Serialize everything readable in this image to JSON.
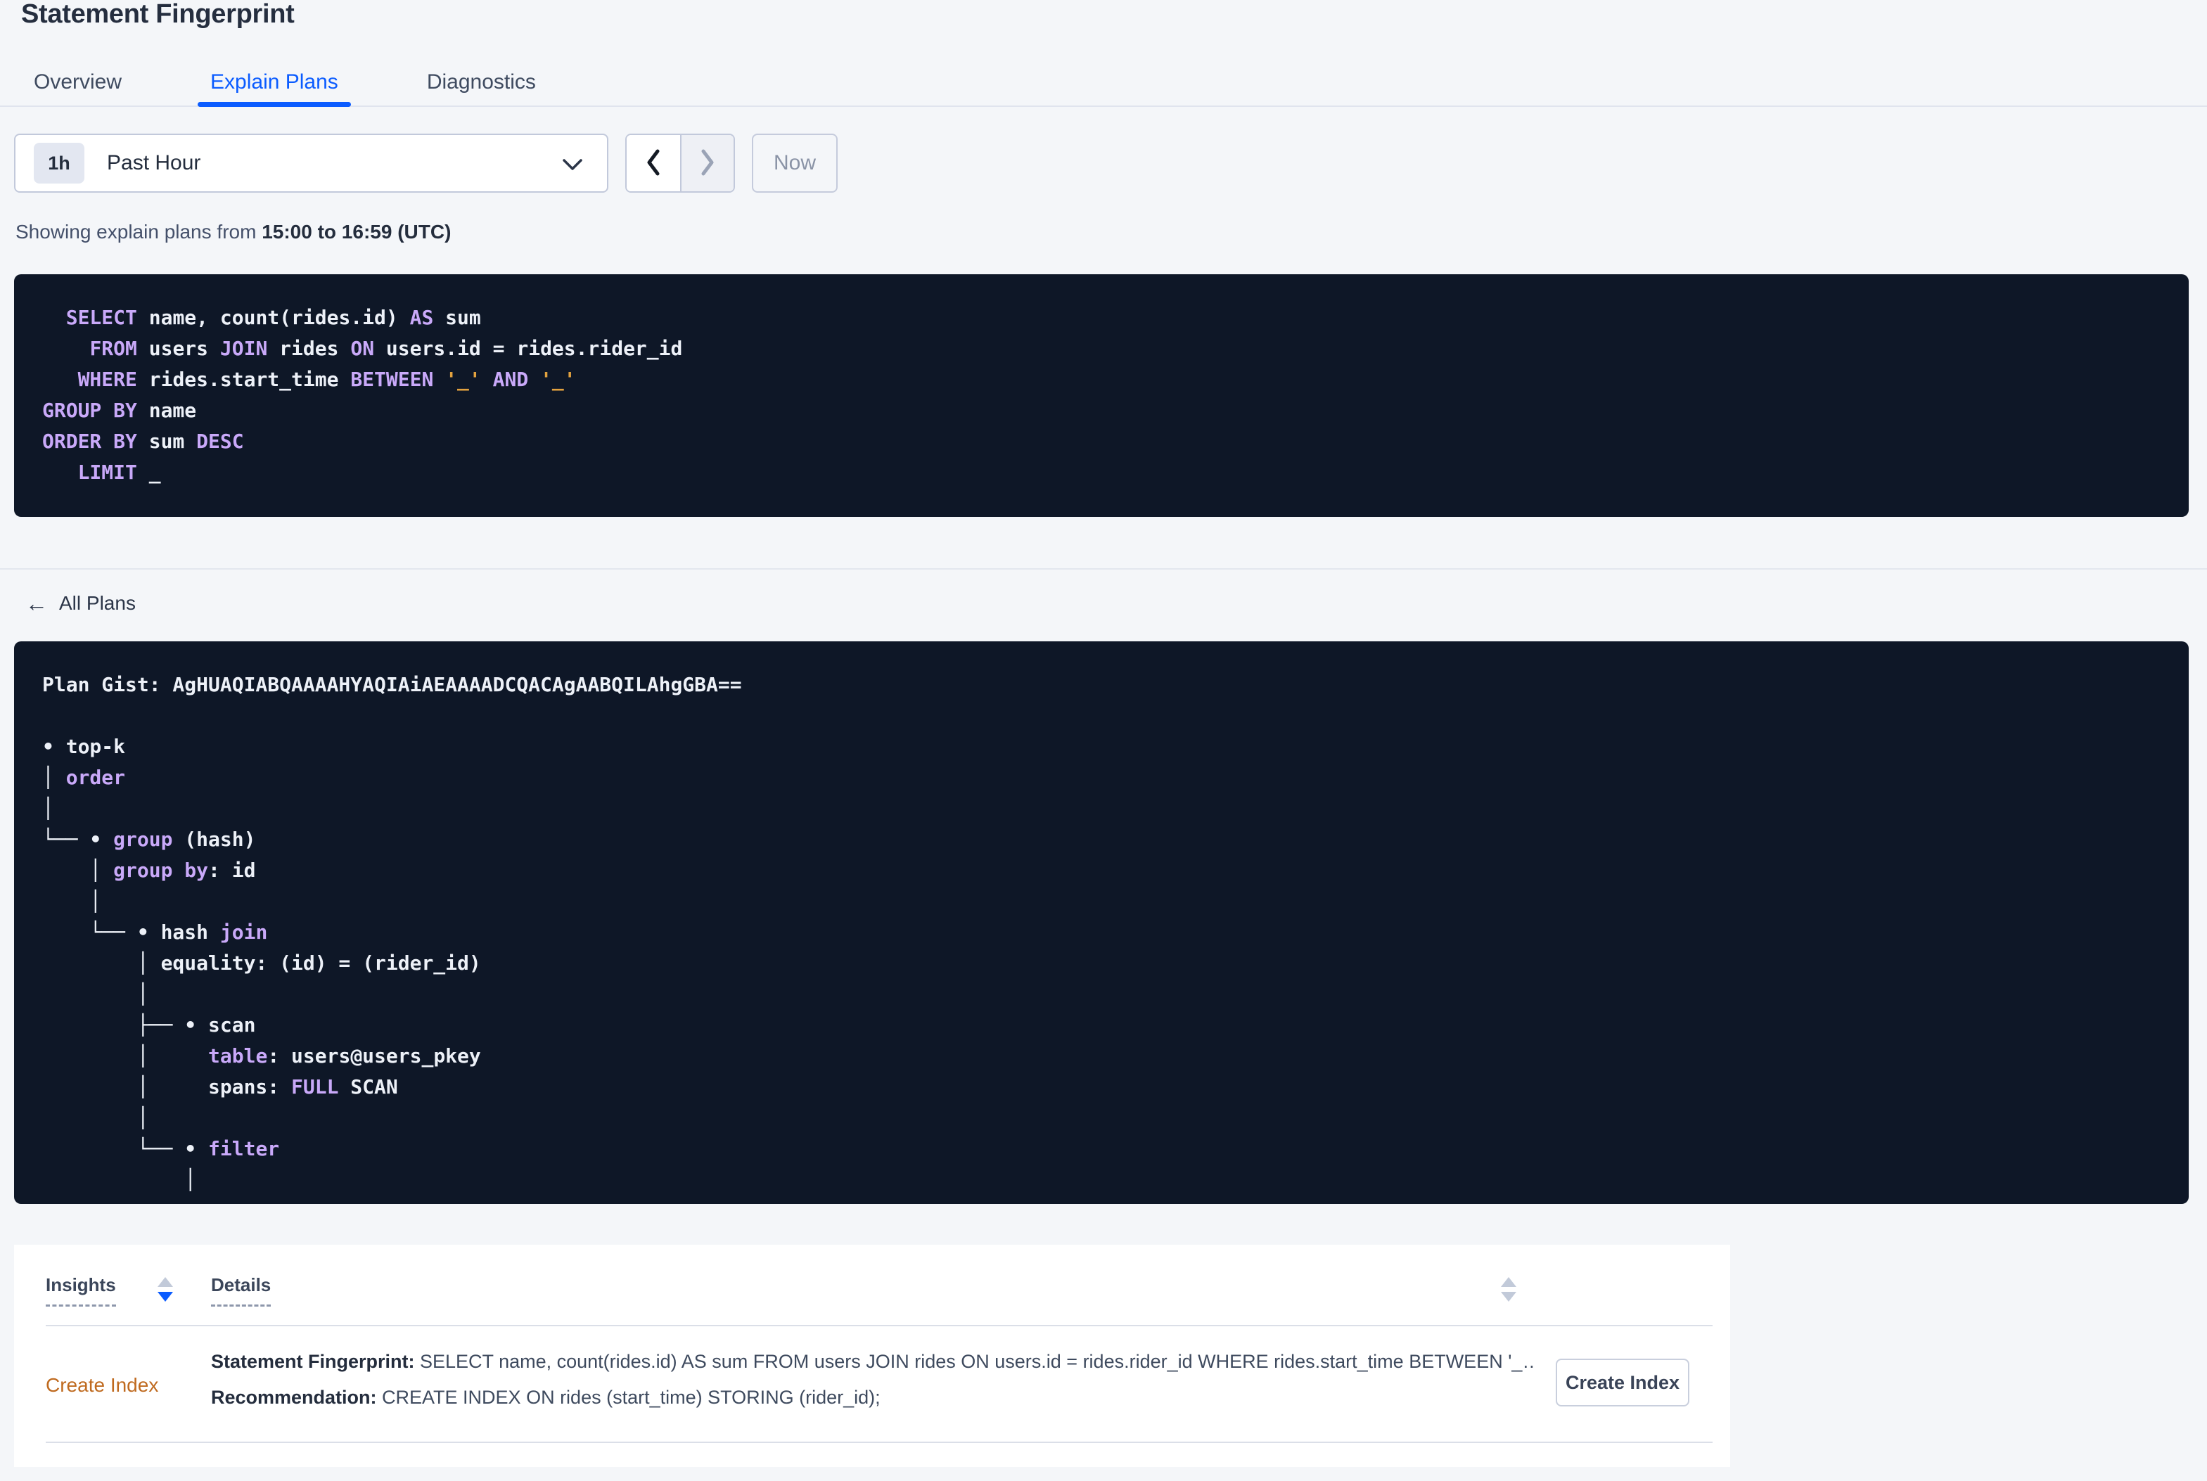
{
  "colors": {
    "accent_blue": "#0b5cff",
    "keyword_purple": "#c9a9f9",
    "string_orange": "#e2a23f",
    "insight_orange": "#bf6a1f",
    "code_background": "#0e1727"
  },
  "page": {
    "title": "Statement Fingerprint"
  },
  "tabs": [
    {
      "label": "Overview",
      "active": false
    },
    {
      "label": "Explain Plans",
      "active": true
    },
    {
      "label": "Diagnostics",
      "active": false
    }
  ],
  "time": {
    "badge": "1h",
    "label": "Past Hour",
    "now_label": "Now"
  },
  "caption": {
    "prefix": "Showing explain plans from ",
    "bold": "15:00 to 16:59 (UTC)"
  },
  "sql_lines": [
    [
      [
        "t",
        "  "
      ],
      [
        "k",
        "SELECT"
      ],
      [
        "t",
        " name, count(rides.id) "
      ],
      [
        "k",
        "AS"
      ],
      [
        "t",
        " sum"
      ]
    ],
    [
      [
        "t",
        "    "
      ],
      [
        "k",
        "FROM"
      ],
      [
        "t",
        " users "
      ],
      [
        "k",
        "JOIN"
      ],
      [
        "t",
        " rides "
      ],
      [
        "k",
        "ON"
      ],
      [
        "t",
        " users.id = rides.rider_id"
      ]
    ],
    [
      [
        "t",
        "   "
      ],
      [
        "k",
        "WHERE"
      ],
      [
        "t",
        " rides.start_time "
      ],
      [
        "k",
        "BETWEEN"
      ],
      [
        "t",
        " "
      ],
      [
        "s",
        "'_'"
      ],
      [
        "t",
        " "
      ],
      [
        "k",
        "AND"
      ],
      [
        "t",
        " "
      ],
      [
        "s",
        "'_'"
      ]
    ],
    [
      [
        "k",
        "GROUP BY"
      ],
      [
        "t",
        " name"
      ]
    ],
    [
      [
        "k",
        "ORDER BY"
      ],
      [
        "t",
        " sum "
      ],
      [
        "k",
        "DESC"
      ]
    ],
    [
      [
        "t",
        "   "
      ],
      [
        "k",
        "LIMIT"
      ],
      [
        "t",
        " _"
      ]
    ]
  ],
  "all_plans": {
    "label": "All Plans"
  },
  "plan_lines": [
    [
      [
        "t",
        "Plan Gist: AgHUAQIABQAAAAHYAQIAiAEAAAADCQACAgAABQILAhgGBA=="
      ]
    ],
    [],
    [
      [
        "t",
        "• top-k"
      ]
    ],
    [
      [
        "t",
        "│ "
      ],
      [
        "k",
        "order"
      ]
    ],
    [
      [
        "t",
        "│"
      ]
    ],
    [
      [
        "t",
        "└── • "
      ],
      [
        "k",
        "group"
      ],
      [
        "t",
        " (hash)"
      ]
    ],
    [
      [
        "t",
        "    │ "
      ],
      [
        "k",
        "group by"
      ],
      [
        "t",
        ": id"
      ]
    ],
    [
      [
        "t",
        "    │"
      ]
    ],
    [
      [
        "t",
        "    └── • hash "
      ],
      [
        "k",
        "join"
      ]
    ],
    [
      [
        "t",
        "        │ equality: (id) = (rider_id)"
      ]
    ],
    [
      [
        "t",
        "        │"
      ]
    ],
    [
      [
        "t",
        "        ├── • scan"
      ]
    ],
    [
      [
        "t",
        "        │     "
      ],
      [
        "k",
        "table"
      ],
      [
        "t",
        ": users@users_pkey"
      ]
    ],
    [
      [
        "t",
        "        │     spans: "
      ],
      [
        "k",
        "FULL"
      ],
      [
        "t",
        " SCAN"
      ]
    ],
    [
      [
        "t",
        "        │"
      ]
    ],
    [
      [
        "t",
        "        └── • "
      ],
      [
        "k",
        "filter"
      ]
    ],
    [
      [
        "t",
        "            │"
      ]
    ]
  ],
  "table": {
    "headers": [
      {
        "label": "Insights",
        "sort": "desc"
      },
      {
        "label": "Details",
        "sort": "none"
      }
    ],
    "rows": [
      {
        "insight": "Create Index",
        "details": [
          {
            "label": "Statement Fingerprint:",
            "text": " SELECT name, count(rides.id) AS sum FROM users JOIN rides ON users.id = rides.rider_id WHERE rides.start_time BETWEEN '_…"
          },
          {
            "label": "Recommendation:",
            "text": " CREATE INDEX ON rides (start_time) STORING (rider_id);"
          }
        ],
        "action_label": "Create Index"
      }
    ]
  }
}
